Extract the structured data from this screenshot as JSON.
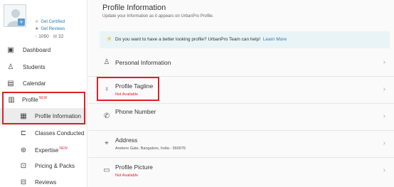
{
  "sidebar": {
    "card": {
      "get_certified": "Get Certified",
      "get_reviews": "Get Reviews",
      "views": "1050",
      "items": "22"
    },
    "nav": [
      {
        "label": "Dashboard",
        "icon": "dashboard-icon"
      },
      {
        "label": "Students",
        "icon": "students-icon"
      },
      {
        "label": "Calendar",
        "icon": "calendar-icon"
      },
      {
        "label": "Profile",
        "badge": "NEW",
        "icon": "profile-icon"
      },
      {
        "label": "Profile Information",
        "icon": "profile-info-icon"
      },
      {
        "label": "Classes Conducted",
        "icon": "classes-icon"
      },
      {
        "label": "Expertise",
        "badge": "NEW",
        "icon": "expertise-icon"
      },
      {
        "label": "Pricing & Packs",
        "icon": "pricing-icon"
      },
      {
        "label": "Reviews",
        "icon": "reviews-icon"
      }
    ]
  },
  "main": {
    "title": "Profile Information",
    "subtitle": "Update your Information as it appears on UrbanPro Profile.",
    "promo": {
      "text": "Do you want to have a better looking profile? UrbanPro Team can help!",
      "link": "Learn More"
    },
    "rows": [
      {
        "title": "Personal Information",
        "value": ""
      },
      {
        "title": "Profile Tagline",
        "value": "Not Available"
      },
      {
        "title": "Phone Number",
        "value": ""
      },
      {
        "title": "Address",
        "value": "Arekere Gate, Bangalore, India - 560076"
      },
      {
        "title": "Profile Picture",
        "value": "Not Available"
      }
    ]
  },
  "colors": {
    "accent": "#2a7ab8",
    "highlight": "#e0202a",
    "promo_bg": "#e9f4f6"
  }
}
